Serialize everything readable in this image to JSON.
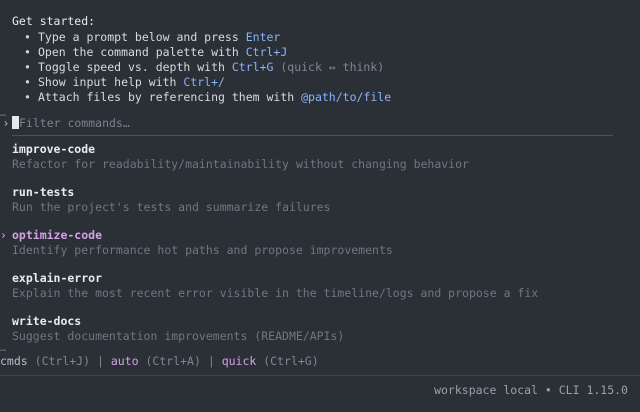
{
  "help": {
    "title": "Get started:",
    "items": [
      {
        "pre": "Type a prompt below and press ",
        "hl": "Enter",
        "post": ""
      },
      {
        "pre": "Open the command palette with ",
        "hl": "Ctrl+J",
        "post": ""
      },
      {
        "pre": "Toggle speed vs. depth with ",
        "hl": "Ctrl+G",
        "post": "  (quick ↔ think)"
      },
      {
        "pre": "Show input help with ",
        "hl": "Ctrl+/",
        "post": ""
      },
      {
        "pre": "Attach files by referencing them with ",
        "hl": "@path/to/file",
        "post": ""
      }
    ]
  },
  "ellipsis": "…",
  "filter": {
    "chevron": "›",
    "placeholder": "Filter commands…",
    "value": ""
  },
  "commands": [
    {
      "name": "improve-code",
      "description": "Refactor for readability/maintainability without changing behavior",
      "selected": false
    },
    {
      "name": "run-tests",
      "description": "Run the project's tests and summarize failures",
      "selected": false
    },
    {
      "name": "optimize-code",
      "description": "Identify performance hot paths and propose improvements",
      "selected": true
    },
    {
      "name": "explain-error",
      "description": "Explain the most recent error visible in the timeline/logs and propose a fix",
      "selected": false
    },
    {
      "name": "write-docs",
      "description": "Suggest documentation improvements (README/APIs)",
      "selected": false
    }
  ],
  "status": {
    "cmds_label": "cmds",
    "cmds_key": "(Ctrl+J)",
    "sep": "|",
    "auto_label": "auto",
    "auto_key": "(Ctrl+A)",
    "quick_label": "quick",
    "quick_key": "(Ctrl+G)"
  },
  "footer": {
    "workspace": "workspace local",
    "dot": "•",
    "version": "CLI 1.15.0"
  },
  "colors": {
    "background": "#2b2f36",
    "accent_blue": "#89b4fa",
    "accent_pink": "#d4a3e6"
  }
}
